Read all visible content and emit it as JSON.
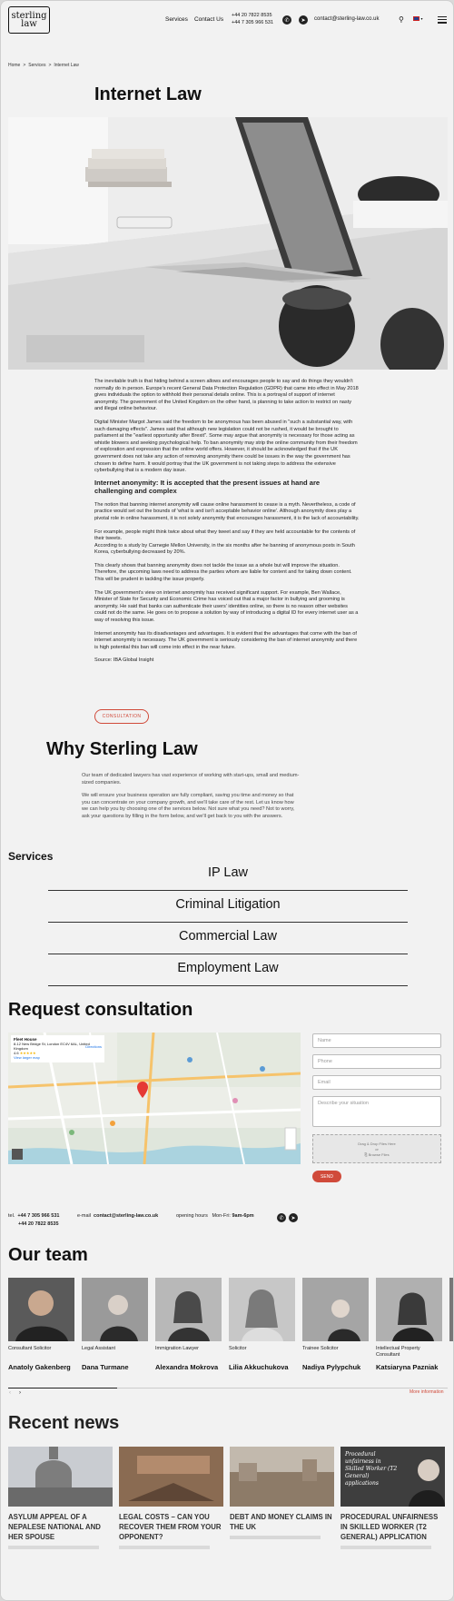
{
  "header": {
    "logo_line1": "sterling",
    "logo_line2": "law",
    "nav": [
      "Services",
      "Contact Us"
    ],
    "phone1": "+44 20 7822 8535",
    "phone2": "+44 7 305 966 531",
    "email": "contact@sterling-law.co.uk",
    "lang": "EN"
  },
  "breadcrumb": [
    "Home",
    "Services",
    "Internet Law"
  ],
  "page_title": "Internet Law",
  "article": {
    "p1": "The inevitable truth is that hiding behind a screen allows and encourages people to say and do things they wouldn't normally do in person. Europe's recent General Data Protection Regulation (GDPR) that came into effect in May 2018 gives individuals the option to withhold their personal details online. This is a portrayal of support of internet anonymity. The government of the United Kingdom on the other hand, is planning to take action to restrict on nasty and illegal online behaviour.",
    "p2": "Digital Minister Margot James said the freedom to be anonymous has been abused in \"such a substantial way, with such damaging effects\". James said that although new legislation could not be rushed, it would be brought to parliament at the \"earliest opportunity after Brexit\". Some may argue that anonymity is necessary for those acting as whistle blowers and seeking psychological help. To ban anonymity may strip the online community from their freedom of exploration and expression that the online world offers. However, it should be acknowledged that if the UK government does not take any action of removing anonymity there could be issues in the way the government has chosen to define harm. It would portray that the UK government is not taking steps to address the extensive cyberbullying that is a modern day issue.",
    "h3": "Internet anonymity: It is accepted that the present issues at hand are challenging and complex",
    "p3": "The notion that banning internet anonymity will cause online harassment to cease is a myth. Nevertheless, a code of practice would set out the bounds of 'what is and isn't acceptable behavior online'. Although anonymity does play a pivotal role in online harassment, it is not solely anonymity that encourages harassment, it is the lack of accountability.",
    "p4": "For example, people might think twice about what they tweet and say if they are held accountable for the contents of their tweets.\nAccording to a study by Carnegie Mellon University, in the six months after he banning of anonymous posts in South Korea, cyberbullying decreased by 20%.",
    "p5": "This clearly shows that banning anonymity does not tackle the issue as a whole but will improve the situation. Therefore, the upcoming laws need to address the parties whom are liable for content and for taking down content. This will be prudent in tackling the issue properly.",
    "p6": "The UK government's view on internet anonymity has received significant support. For example, Ben Wallace, Minister of State for Security and Economic Crime has voiced out that a major factor in bullying and grooming is anonymity. He said that banks can authenticate their users' identities online, so there is no reason other websites could not do the same. He goes on to propose a solution by way of introducing a digital ID for every internet user as a way of resolving this issue.",
    "p7": "Internet anonymity has its disadvantages and advantages. It is evident that the advantages that come with the ban of internet anonymity is necessary. The UK government is seriously considering the ban of internet anonymity and there is high potential this ban will come into effect in the near future.",
    "source": "Source: IBA Global Insight",
    "button": "CONSULTATION"
  },
  "why": {
    "title": "Why Sterling Law",
    "p1": "Our team of dedicated lawyers has vast experience of working with start-ups, small and medium-sized companies.",
    "p2": "We will ensure your business operation are fully compliant, saving you time and money so that you can concentrate on your company growth, and we'll take care of the rest. Let us know how we can help you by choosing one of the services below. Not sure what you need? Not to worry, ask your questions by filling in the form below, and we'll get back to you with the answers."
  },
  "services": {
    "heading": "Services",
    "items": [
      "IP Law",
      "Criminal Litigation",
      "Commercial Law",
      "Employment Law"
    ]
  },
  "request": {
    "title": "Request consultation",
    "map_place": "Fleet House",
    "map_address": "8-12 New Bridge St, London EC4V 6AL, United Kingdom",
    "map_rating": "4.6",
    "map_link": "View larger map",
    "map_directions": "Directions",
    "placeholders": [
      "Name",
      "Phone",
      "Email",
      "Describe your situation"
    ],
    "drop_text": "Drag & Drop Files Here",
    "drop_or": "or",
    "drop_browse": "Browse Files",
    "send": "SEND"
  },
  "contact_bar": {
    "tel_label": "tel.",
    "tel1": "+44 7 305 966 531",
    "tel2": "+44 20 7822 8535",
    "email_label": "e-mail",
    "email": "contact@sterling-law.co.uk",
    "hours_label": "opening hours",
    "hours_days": "Mon-Fri:",
    "hours_time": "9am-6pm"
  },
  "team": {
    "title": "Our team",
    "members": [
      {
        "role": "Consultant Solicitor",
        "name": "Anatoly Gakenberg"
      },
      {
        "role": "Legal Assistant",
        "name": "Dana Turmane"
      },
      {
        "role": "Immigration Lawyer",
        "name": "Alexandra Mokrova"
      },
      {
        "role": "Solicitor",
        "name": "Lilia Akkuchukova"
      },
      {
        "role": "Trainee Solicitor",
        "name": "Nadiya Pylypchuk"
      },
      {
        "role": "Intellectual Property Consultant",
        "name": "Katsiaryna Pazniak"
      }
    ],
    "more": "More information"
  },
  "news": {
    "title": "Recent news",
    "items": [
      {
        "title": "ASYLUM APPEAL OF A NEPALESE NATIONAL AND HER SPOUSE"
      },
      {
        "title": "LEGAL COSTS – CAN YOU RECOVER THEM FROM YOUR OPPONENT?"
      },
      {
        "title": "DEBT AND MONEY CLAIMS IN THE UK"
      },
      {
        "title": "PROCEDURAL UNFAIRNESS IN SKILLED WORKER (T2 GENERAL) APPLICATION"
      }
    ],
    "overlay_text": "Procedural unfairness in Skilled Worker (T2 General) applications"
  },
  "colors": {
    "accent": "#d04a3a",
    "page_bg": "#f2f2f2",
    "text": "#111111"
  }
}
